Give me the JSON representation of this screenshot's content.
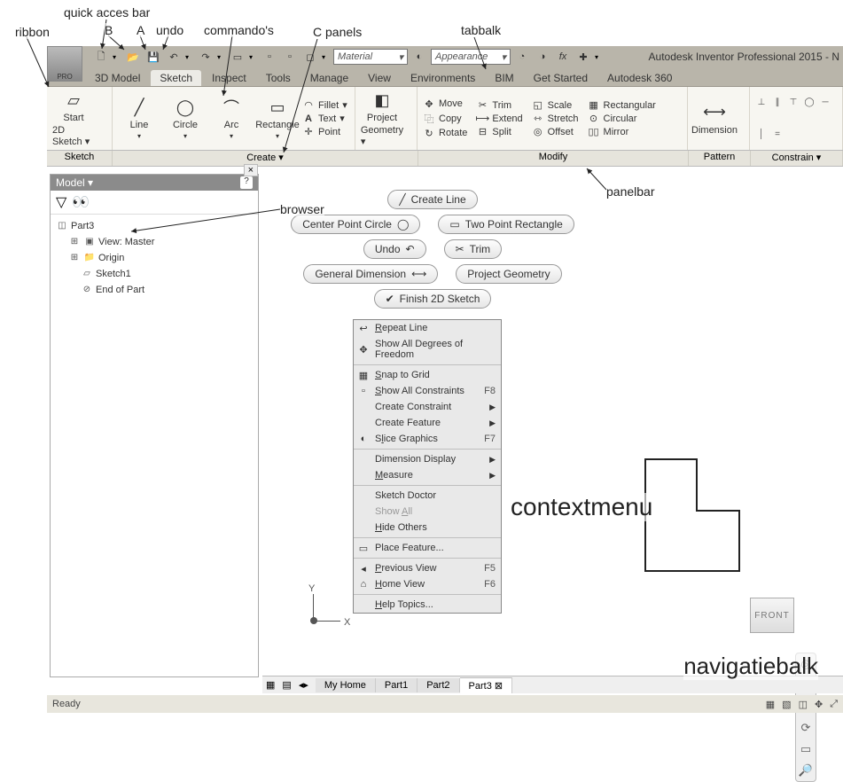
{
  "annotations": {
    "quick_access": "quick acces bar",
    "ribbon": "ribbon",
    "b": "B",
    "a": "A",
    "undo": "undo",
    "commandos": "commando's",
    "panels": "C panels",
    "tabbalk": "tabbalk",
    "panelbar": "panelbar",
    "browser": "browser",
    "contextmenu": "contextmenu",
    "navigatiebalk": "navigatiebalk"
  },
  "title": "Autodesk Inventor Professional 2015 - N",
  "material_label": "Material",
  "appearance_label": "Appearance",
  "fx_label": "fx",
  "logo_sub": "PRO",
  "tabs": [
    "3D Model",
    "Sketch",
    "Inspect",
    "Tools",
    "Manage",
    "View",
    "Environments",
    "BIM",
    "Get Started",
    "Autodesk 360"
  ],
  "active_tab": 1,
  "ribbon_panels": {
    "sketch": {
      "label": "Sketch",
      "start": "Start",
      "start2": "2D Sketch"
    },
    "create": {
      "label": "Create ▾",
      "line": "Line",
      "circle": "Circle",
      "arc": "Arc",
      "rect": "Rectangle",
      "fillet": "Fillet",
      "text": "Text",
      "point": "Point",
      "project": "Project",
      "project2": "Geometry"
    },
    "modify": {
      "label": "Modify",
      "move": "Move",
      "copy": "Copy",
      "rotate": "Rotate",
      "trim": "Trim",
      "extend": "Extend",
      "split": "Split",
      "scale": "Scale",
      "stretch": "Stretch",
      "offset": "Offset",
      "rectp": "Rectangular",
      "circp": "Circular",
      "mirror": "Mirror"
    },
    "pattern": {
      "label": "Pattern",
      "dimension": "Dimension"
    },
    "constrain": {
      "label": "Constrain ▾"
    }
  },
  "browser": {
    "title": "Model ▾",
    "filter_icon": "funnel-icon",
    "find_icon": "binoculars-icon",
    "tree": {
      "root": "Part3",
      "view": "View: Master",
      "origin": "Origin",
      "sketch": "Sketch1",
      "end": "End of Part"
    }
  },
  "mini_toolbar": {
    "create_line": "Create Line",
    "center_circle": "Center Point Circle",
    "two_point_rect": "Two Point Rectangle",
    "undo": "Undo",
    "trim": "Trim",
    "general_dim": "General Dimension",
    "project_geom": "Project Geometry",
    "finish": "Finish 2D Sketch"
  },
  "context_menu": [
    {
      "label": "Repeat Line",
      "u": "R",
      "icon": "↩"
    },
    {
      "label": "Show All Degrees of Freedom",
      "icon": "✥"
    },
    {
      "sep": true
    },
    {
      "label": "Snap to Grid",
      "u": "S",
      "icon": "▦"
    },
    {
      "label": "Show All Constraints",
      "u": "S",
      "sc": "F8",
      "icon": "▫"
    },
    {
      "label": "Create Constraint",
      "sub": true
    },
    {
      "label": "Create Feature",
      "sub": true
    },
    {
      "label": "Slice Graphics",
      "u": "l",
      "sc": "F7",
      "icon": "◐"
    },
    {
      "sep": true
    },
    {
      "label": "Dimension Display",
      "sub": true
    },
    {
      "label": "Measure",
      "u": "M",
      "sub": true
    },
    {
      "sep": true
    },
    {
      "label": "Sketch Doctor"
    },
    {
      "label": "Show All",
      "u": "A",
      "dis": true
    },
    {
      "label": "Hide Others",
      "u": "H"
    },
    {
      "sep": true
    },
    {
      "label": "Place Feature...",
      "icon": "▭"
    },
    {
      "sep": true
    },
    {
      "label": "Previous View",
      "u": "P",
      "sc": "F5",
      "icon": "◂"
    },
    {
      "label": "Home View",
      "u": "H",
      "sc": "F6",
      "icon": "⌂"
    },
    {
      "sep": true
    },
    {
      "label": "Help Topics...",
      "u": "H"
    }
  ],
  "viewcube": "FRONT",
  "doc_tabs": [
    "My Home",
    "Part1",
    "Part2",
    "Part3"
  ],
  "active_doc": 3,
  "status": "Ready",
  "axis": {
    "x": "X",
    "y": "Y"
  }
}
